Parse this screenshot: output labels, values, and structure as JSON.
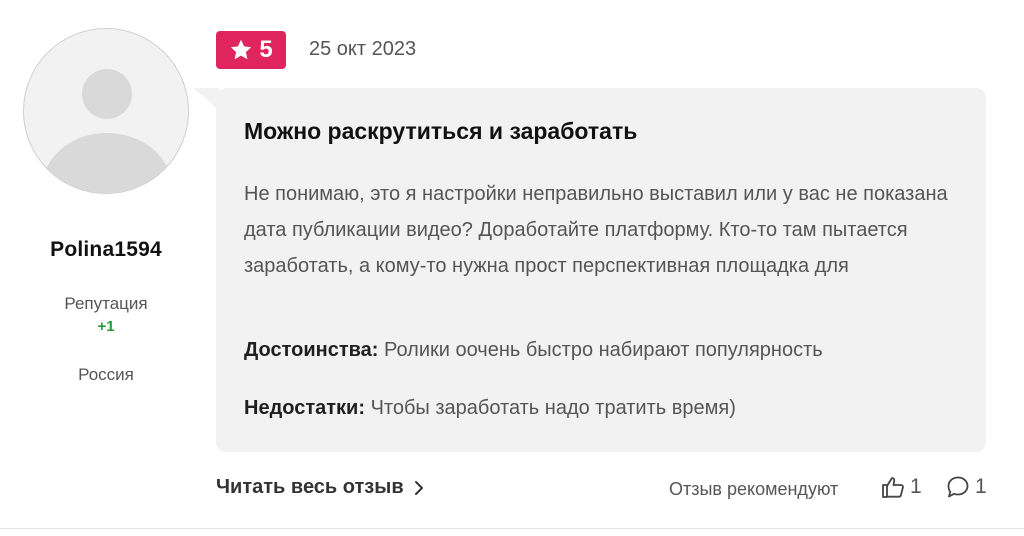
{
  "user": {
    "username": "Polina1594",
    "reputation_label": "Репутация",
    "reputation_value": "+1",
    "country": "Россия"
  },
  "review": {
    "rating": "5",
    "date": "25 окт 2023",
    "title": "Можно раскрутиться и заработать",
    "text": "Не понимаю, это я настройки неправильно выставил или у вас не показана дата публикации видео? Доработайте платформу. Кто-то там пытается заработать, а кому-то нужна прост перспективная площадка для",
    "pros_label": "Достоинства:",
    "pros_text": "Ролики оочень быстро набирают популярность",
    "cons_label": "Недостатки:",
    "cons_text": "Чтобы заработать надо тратить время)"
  },
  "footer": {
    "read_more": "Читать весь отзыв",
    "recommend_label": "Отзыв рекомендуют",
    "likes_count": "1",
    "comments_count": "1"
  },
  "colors": {
    "rating_badge": "#e0245e",
    "reputation_positive": "#2e9a3a",
    "bubble_bg": "#f2f2f2"
  },
  "icons": {
    "rating": "star-icon",
    "read_more": "chevron-right-icon",
    "likes": "thumbs-up-icon",
    "comments": "comment-icon"
  }
}
